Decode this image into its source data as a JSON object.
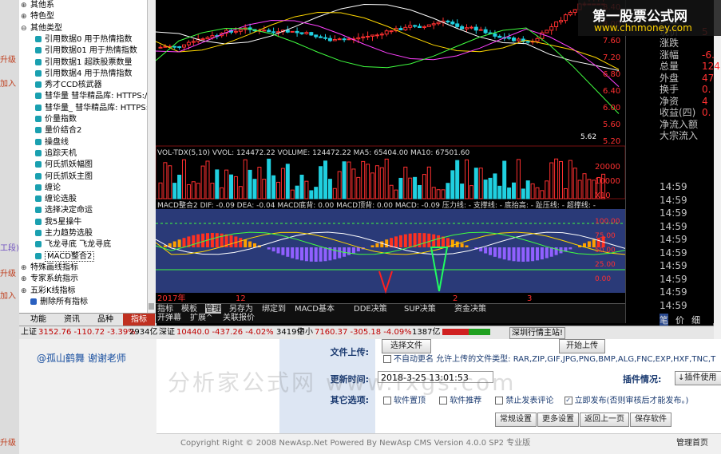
{
  "tree": {
    "items": [
      {
        "label": "其他系",
        "type": "folder"
      },
      {
        "label": "特色型",
        "type": "folder"
      },
      {
        "label": "其他类型",
        "type": "folder-open"
      },
      {
        "label": "引用数据0 用于热情指数",
        "type": "leaf"
      },
      {
        "label": "引用数据01 用于热情指数",
        "type": "leaf"
      },
      {
        "label": "引用数据1 超跌股票数量",
        "type": "leaf"
      },
      {
        "label": "引用数据4 用于热情指数",
        "type": "leaf"
      },
      {
        "label": "秀才CCD核武器",
        "type": "leaf"
      },
      {
        "label": "彗华量 彗华精品库: HTTPS:/",
        "type": "leaf"
      },
      {
        "label": "彗华量_ 彗华精品库: HTTPS:",
        "type": "leaf"
      },
      {
        "label": "价量指数",
        "type": "leaf"
      },
      {
        "label": "量价结合2",
        "type": "leaf"
      },
      {
        "label": "操盘线",
        "type": "leaf"
      },
      {
        "label": "追踪天机",
        "type": "leaf"
      },
      {
        "label": "何氏抓妖幅图",
        "type": "leaf"
      },
      {
        "label": "何氏抓妖主图",
        "type": "leaf"
      },
      {
        "label": "缠论",
        "type": "leaf"
      },
      {
        "label": "缠论选股",
        "type": "leaf"
      },
      {
        "label": "选择决定命运",
        "type": "leaf"
      },
      {
        "label": "我5星操牛",
        "type": "leaf"
      },
      {
        "label": "主力趋势选股",
        "type": "leaf"
      },
      {
        "label": "飞龙寻底 飞龙寻底",
        "type": "leaf"
      },
      {
        "label": "MACD整合2",
        "type": "leaf-selected"
      },
      {
        "label": "特殊画线指标",
        "type": "folder"
      },
      {
        "label": "专家系统指示",
        "type": "folder"
      },
      {
        "label": "五彩K线指标",
        "type": "folder"
      },
      {
        "label": "删除所有指标",
        "type": "action"
      }
    ],
    "tabs": [
      "功能",
      "资讯",
      "品种",
      "指标"
    ]
  },
  "left_strip": {
    "labels": [
      "升级",
      "加入",
      "工段)",
      "升级",
      "加入",
      "升级"
    ]
  },
  "chart": {
    "price_labels": [
      "8.40",
      "8.00",
      "7.60",
      "7.20",
      "6.80",
      "6.40",
      "6.00",
      "5.60",
      "5.20"
    ],
    "low_mark": "5.62",
    "vol_header": "VOL-TDX(5,10) VVOL: 124472.22 VOLUME: 124472.22 MA5: 65404.00 MA10: 67501.60",
    "vol_labels": [
      "20000",
      "10000",
      "X10"
    ],
    "macd_header": "MACD整合2 DIF: -0.09 DEA: -0.04 MACD底背: 0.00 MACD顶背: 0.00 MACD: -0.09 压力线: - 支撑线: - 底抬高: - 趾压线: - 超撑线: -",
    "macd_labels": [
      "100.00",
      "75.00",
      "50.00",
      "25.00",
      "0.00"
    ],
    "date_labels": [
      "2017年",
      "12",
      "2",
      "3"
    ],
    "year_label": "2017年"
  },
  "bottom_tabs": [
    "指标",
    "模板",
    "管理",
    "另存为",
    "绑定到",
    "MACD基本",
    "DDE决策",
    "SUP决策",
    "资金决策"
  ],
  "bottom_tabs2": [
    "开弹幕",
    "扩展^",
    "关联报价"
  ],
  "right_panel": {
    "rows": [
      {
        "label": "买五",
        "value": ""
      },
      {
        "label": "现价",
        "value": "5"
      },
      {
        "label": "涨跌",
        "value": ""
      },
      {
        "label": "涨幅",
        "value": "-6."
      },
      {
        "label": "总量",
        "value": "124"
      },
      {
        "label": "外盘",
        "value": "47"
      },
      {
        "label": "换手",
        "value": "0."
      },
      {
        "label": "净资",
        "value": "4"
      },
      {
        "label": "收益(四)",
        "value": "0."
      },
      {
        "label": "净流入额",
        "value": ""
      },
      {
        "label": "大宗流入",
        "value": ""
      }
    ],
    "times": [
      "14:59",
      "14:59",
      "14:59",
      "14:59",
      "14:59",
      "14:59",
      "14:59",
      "14:59",
      "14:59",
      "14:59"
    ],
    "bottom_tabs": [
      "笔",
      "价",
      "细"
    ]
  },
  "status": {
    "sh_label": "上证",
    "sh_values": "3152.76 -110.72 -3.39%",
    "sh_amount": "2934亿",
    "sz_label": "深证",
    "sz_values": "10440.0 -437.26 -4.02%",
    "sz_amount": "3419亿",
    "zx_label": "中小",
    "zx_values": "7160.37 -305.18 -4.09%",
    "zx_amount": "1387亿",
    "station": "深圳行情主站!"
  },
  "logo": {
    "title": "第一股票公式网",
    "url": "www.chnmoney.com"
  },
  "page": {
    "user_line": "@孤山鹤舞 谢谢老师",
    "file_upload_label": "文件上传:",
    "file_btn_1": "选择文件",
    "file_btn_2": "开始上传",
    "auto_rename": "不自动更名 允许上传的文件类型: RAR,ZIP,GIF,JPG,PNG,BMP,ALG,FNC,EXP,HXF,TNC,T",
    "update_time_label": "更新时间:",
    "update_time_value": "2018-3-25 13:01:53",
    "plugin_label": "插件情况:",
    "plugin_select": "↓插件使用",
    "other_options_label": "其它选项:",
    "opt_top": "软件置顶",
    "opt_recommend": "软件推荐",
    "opt_no_comment": "禁止发表评论",
    "opt_publish": "立即发布(否则审核后才能发布。)",
    "btn_normal": "常规设置",
    "btn_more": "更多设置",
    "btn_back": "返回上一页",
    "btn_save": "保存软件",
    "footer": "Copyright Right © 2008 NewAsp.Net Powered By NewAsp CMS Version 4.0.0 SP2 专业版",
    "footer_right": "管理首页",
    "watermark": "分析家公式网 www.fxgs.com"
  },
  "colors": {
    "up": "#ff3030",
    "down": "#20d0e0",
    "bg": "#000000",
    "accent": "#1aa0b0"
  }
}
